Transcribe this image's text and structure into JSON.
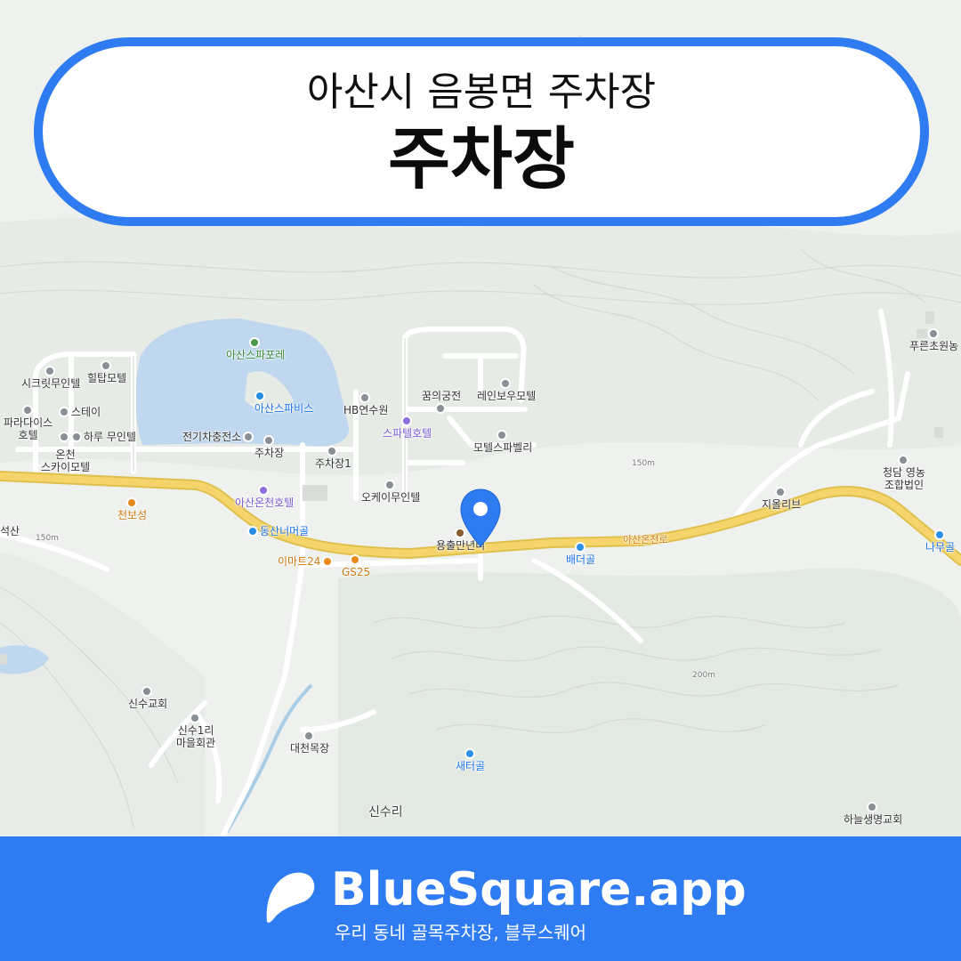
{
  "header": {
    "subtitle": "아산시 음봉면 주차장",
    "title": "주차장"
  },
  "footer": {
    "brand": "BlueSquare.app",
    "tagline": "우리 동네 골목주차장, 블루스퀘어"
  },
  "map": {
    "places": {
      "asan_spa_forest": "아산스파포레",
      "asan_spavis": "아산스파비스",
      "hilltop_motel": "힐탑모텔",
      "secret_inn": "시크릿무인텔",
      "paradise_hotel": "파라다이스\n호텔",
      "stay": "스테이",
      "haru_inn": "하루 무인텔",
      "onchen_sky_motel": "온천\n스카이모텔",
      "ev_station": "전기차충전소",
      "parking": "주차장",
      "parking1": "주차장1",
      "hb_garden": "HB연수원",
      "dream_palace": "꿈의궁전",
      "rainbow_motel": "레인보우모텔",
      "spatel_hotel": "스파텔호텔",
      "motel_spa_valley": "모텔스파벨리",
      "ok_inn": "오케이무인텔",
      "cheonbosung": "천보성",
      "asan_onchen_hotel": "아산온천호텔",
      "dongsan_neomeogol": "동산너머골",
      "seoksan": "석산",
      "emart24": "이마트24",
      "gs25": "GS25",
      "yongchulmannyeon": "용출만년니",
      "baedeogol": "배더골",
      "asan_onchen_ro": "아산온천로",
      "jiolriv": "지올리브",
      "cheongdam_law": "청담 영농\n조합법인",
      "pureun_farm": "푸른초원농",
      "namugol": "나무골",
      "sinsu_church": "신수교회",
      "sinsu1_hall": "신수1리\n마을회관",
      "daecheon_ranch": "대천목장",
      "saeteogol": "새터골",
      "sinsu_ri": "신수리",
      "haneul_church": "하늘생명교회"
    },
    "contours": {
      "c150a": "150m",
      "c150b": "150m",
      "c200": "200m"
    }
  },
  "colors": {
    "accent": "#2f7bf2",
    "road": "#f5d56b",
    "map_bg": "#eef1ee"
  }
}
